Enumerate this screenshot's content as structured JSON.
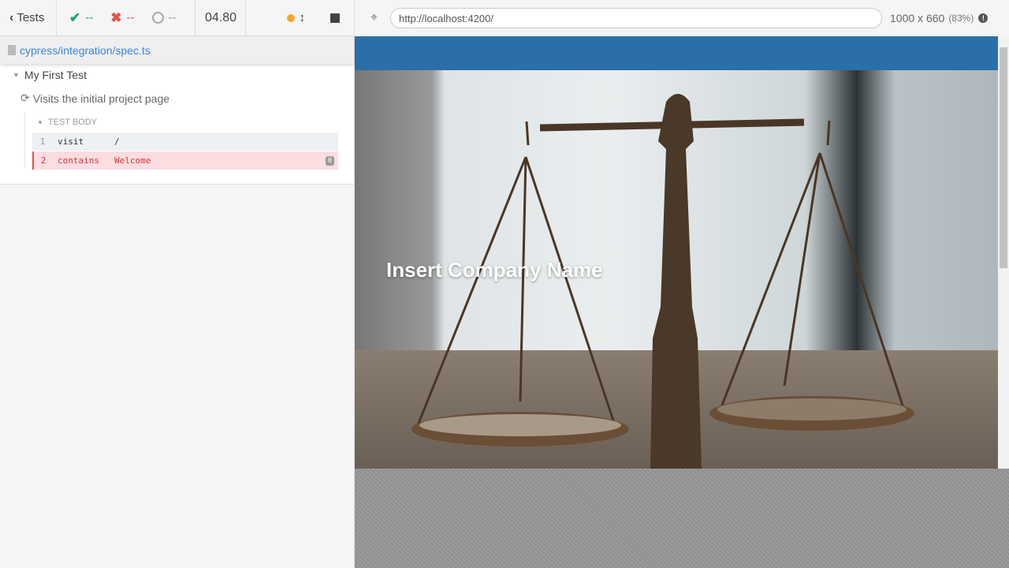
{
  "reporter": {
    "back_label": "Tests",
    "passed": "--",
    "failed": "--",
    "pending": "--",
    "duration": "04.80",
    "spec_path": "cypress/integration/spec.ts",
    "suite_title": "My First Test",
    "test_title": "Visits the initial project page",
    "hook_title": "TEST BODY",
    "commands": [
      {
        "number": "1",
        "name": "visit",
        "message": "/",
        "state": "passed"
      },
      {
        "number": "2",
        "name": "contains",
        "message": "Welcome",
        "state": "failed",
        "badge": "0"
      }
    ],
    "colors": {
      "passed": "#1aa56b",
      "failed": "#e94f4f",
      "running": "#f7a823",
      "link": "#3a86e8"
    }
  },
  "browser": {
    "url": "http://localhost:4200/",
    "viewport": "1000 x 660",
    "scale": "(83%)"
  },
  "app": {
    "company_name": "Insert Company Name",
    "navbar_color": "#2a6fa8"
  }
}
